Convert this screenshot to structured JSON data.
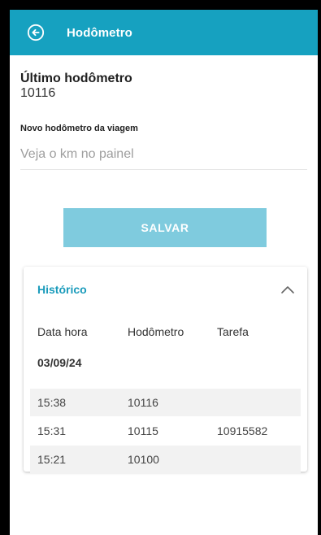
{
  "appbar": {
    "title": "Hodômetro",
    "back_icon": "arrow-left-circle-icon",
    "color": "#16a1c0"
  },
  "last_odometer": {
    "label": "Último hodômetro",
    "value": "10116"
  },
  "new_odometer": {
    "label": "Novo hodômetro da viagem",
    "placeholder": "Veja o km no painel",
    "value": ""
  },
  "save_button": {
    "label": "SALVAR",
    "color": "#7fcbde"
  },
  "history": {
    "title": "Histórico",
    "collapse_icon": "chevron-up-icon",
    "columns": [
      "Data hora",
      "Hodômetro",
      "Tarefa"
    ],
    "date": "03/09/24",
    "rows": [
      {
        "time": "15:38",
        "odometer": "10116",
        "task": ""
      },
      {
        "time": "15:31",
        "odometer": "10115",
        "task": "10915582"
      },
      {
        "time": "15:21",
        "odometer": "10100",
        "task": ""
      }
    ]
  }
}
